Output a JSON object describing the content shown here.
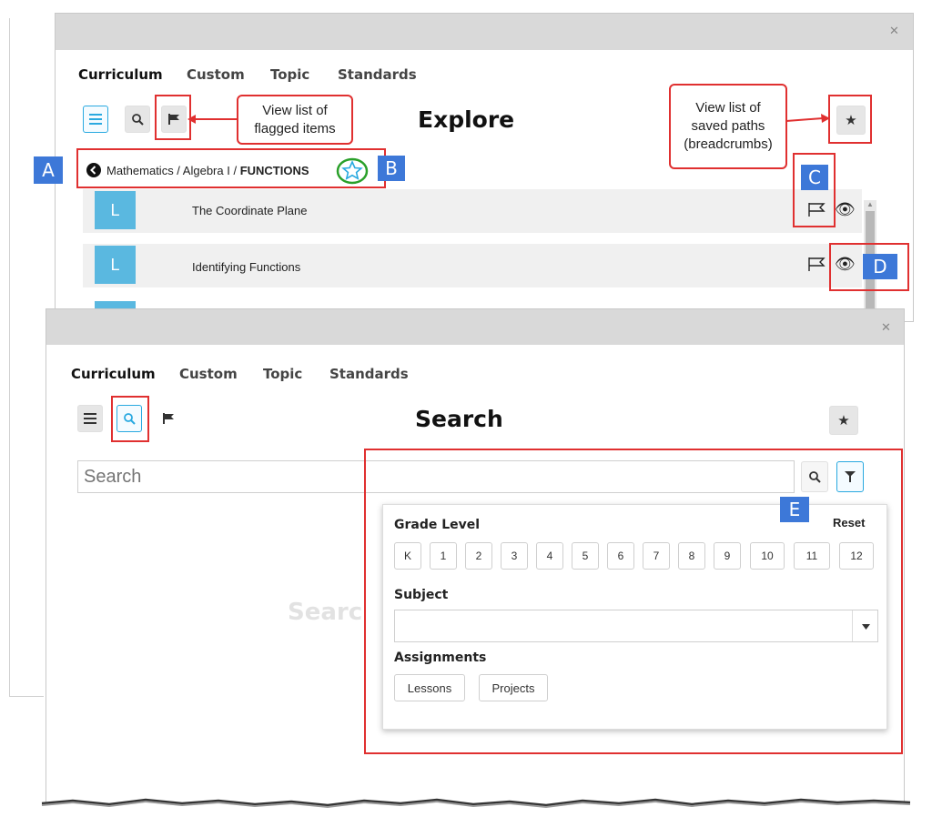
{
  "explore_panel": {
    "close_icon": "close-icon",
    "tabs": [
      {
        "label": "Curriculum",
        "active": true
      },
      {
        "label": "Custom",
        "active": false
      },
      {
        "label": "Topic",
        "active": false
      },
      {
        "label": "Standards",
        "active": false
      }
    ],
    "title": "Explore",
    "toolbar": {
      "list": "list-icon",
      "search": "search-icon",
      "flag": "flag-icon",
      "saved": "star-icon"
    },
    "breadcrumb": {
      "path": "Mathematics / Algebra I / ",
      "current": "FUNCTIONS"
    },
    "items": [
      {
        "tile": "L",
        "title": "The Coordinate Plane"
      },
      {
        "tile": "L",
        "title": "Identifying Functions"
      }
    ]
  },
  "search_panel": {
    "close_icon": "close-icon",
    "tabs": [
      {
        "label": "Curriculum",
        "active": true
      },
      {
        "label": "Custom",
        "active": false
      },
      {
        "label": "Topic",
        "active": false
      },
      {
        "label": "Standards",
        "active": false
      }
    ],
    "title": "Search",
    "search_placeholder": "Search",
    "background_text": "Searc",
    "filter": {
      "grade_label": "Grade Level",
      "reset_label": "Reset",
      "grades": [
        "K",
        "1",
        "2",
        "3",
        "4",
        "5",
        "6",
        "7",
        "8",
        "9",
        "10",
        "11",
        "12"
      ],
      "subject_label": "Subject",
      "subject_value": "",
      "assignments_label": "Assignments",
      "assignments": [
        "Lessons",
        "Projects"
      ]
    }
  },
  "annotations": {
    "flagged_callout": "View list of flagged items",
    "saved_callout": "View list of saved paths (breadcrumbs)",
    "badges": {
      "a": "A",
      "b": "B",
      "c": "C",
      "d": "D",
      "e": "E"
    }
  },
  "colors": {
    "accent": "#29a9e0",
    "callout_red": "#e03030",
    "badge_blue": "#3d78d8",
    "tile_blue": "#5ab8e0"
  }
}
